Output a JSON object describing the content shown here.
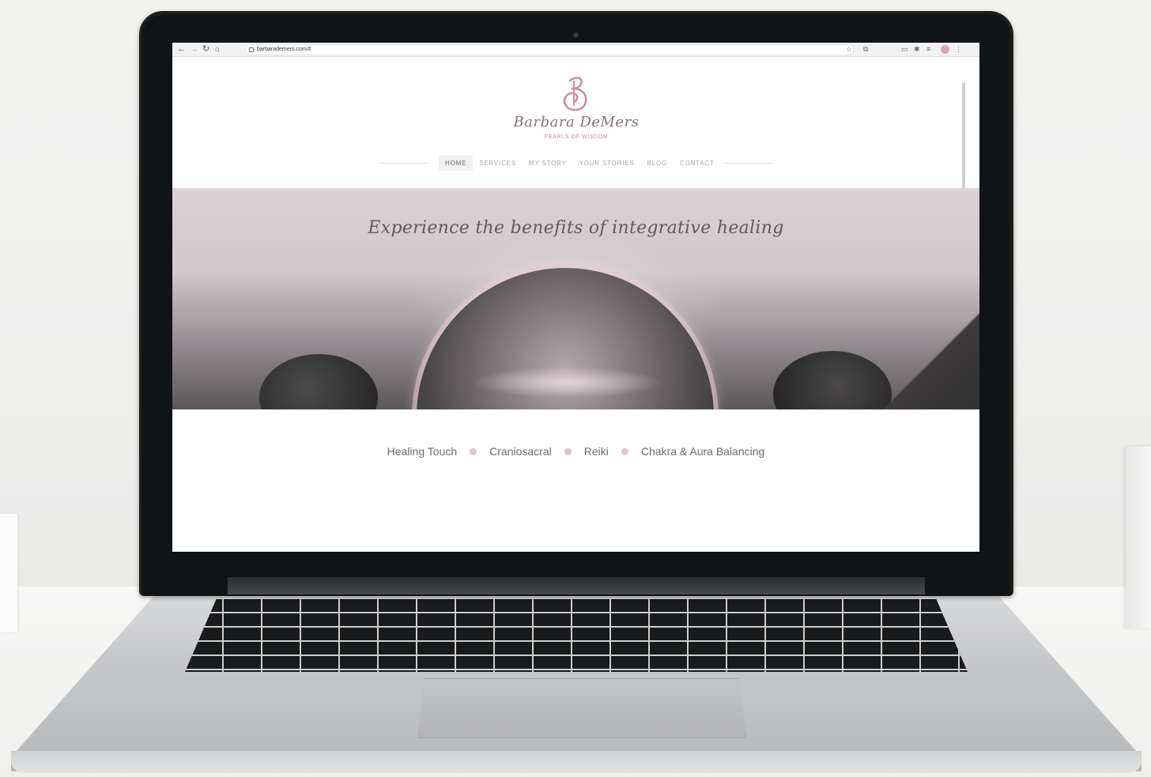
{
  "colors": {
    "accent": "#c98fa0",
    "brand_text": "#8a6f78",
    "nav_active_bg": "#f1f1f1",
    "bullet": "#e6c2cd"
  },
  "browser": {
    "back_icon": "back-arrow-icon",
    "forward_icon": "forward-arrow-icon",
    "reload_icon": "reload-icon",
    "home_icon": "home-icon",
    "url": "barbarademers.com/#"
  },
  "site": {
    "brand": {
      "logo_icon": "b-monogram-icon",
      "name": "Barbara DeMers",
      "tagline": "PEARLS OF WISDOM"
    },
    "nav": [
      {
        "label": "HOME",
        "active": true
      },
      {
        "label": "SERVICES",
        "active": false
      },
      {
        "label": "MY STORY",
        "active": false
      },
      {
        "label": "YOUR STORIES",
        "active": false
      },
      {
        "label": "BLOG",
        "active": false
      },
      {
        "label": "CONTACT",
        "active": false
      }
    ],
    "hero": {
      "headline": "Experience the benefits of integrative healing"
    },
    "services": [
      "Healing Touch",
      "Craniosacral",
      "Reiki",
      "Chakra & Aura Balancing"
    ]
  }
}
